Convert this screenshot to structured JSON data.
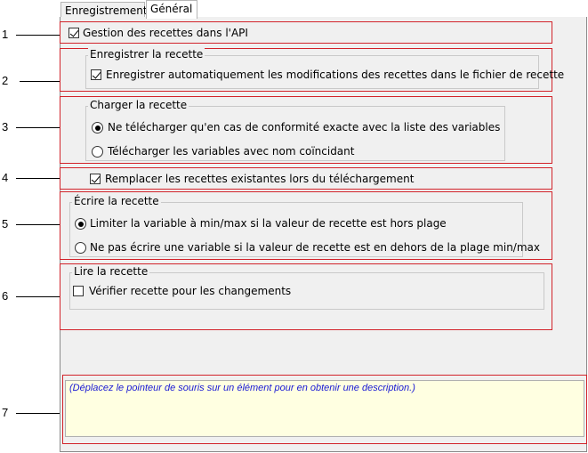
{
  "tabs": [
    {
      "label": "Enregistrement"
    },
    {
      "label": "Général"
    }
  ],
  "callouts": [
    "1",
    "2",
    "3",
    "4",
    "5",
    "6",
    "7"
  ],
  "api_checkbox": {
    "label": "Gestion des recettes dans l'API",
    "checked": true
  },
  "save_group": {
    "title": "Enregistrer la recette",
    "auto_save": {
      "label": "Enregistrer automatiquement les modifications des recettes dans le fichier de recette",
      "checked": true
    }
  },
  "load_group": {
    "title": "Charger la recette",
    "options": [
      {
        "label": "Ne télécharger qu'en cas de conformité exacte avec la liste des variables",
        "selected": true
      },
      {
        "label": "Télécharger les variables avec nom coïncidant",
        "selected": false
      }
    ]
  },
  "replace_checkbox": {
    "label": "Remplacer les recettes existantes lors du téléchargement",
    "checked": true
  },
  "write_group": {
    "title": "Écrire la recette",
    "options": [
      {
        "label": "Limiter la variable à min/max si la valeur de recette est hors plage",
        "selected": true
      },
      {
        "label": "Ne pas écrire une variable si la valeur de recette est en dehors de la plage min/max",
        "selected": false
      }
    ]
  },
  "read_group": {
    "title": "Lire la recette",
    "check_changes": {
      "label": "Vérifier recette pour les changements",
      "checked": false
    }
  },
  "description": {
    "text": "(Déplacez le pointeur de souris sur un élément pour en obtenir une description.)"
  },
  "colors": {
    "callout_frame": "#d2232a",
    "description_bg": "#ffffe1",
    "description_text": "#1a1ad4"
  }
}
